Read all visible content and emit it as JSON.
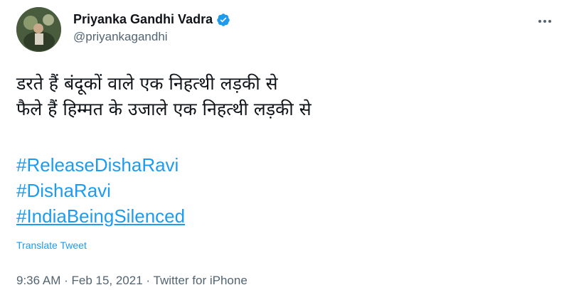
{
  "author": {
    "display_name": "Priyanka Gandhi Vadra",
    "handle": "@priyankagandhi",
    "verified": true
  },
  "tweet": {
    "lines": [
      "डरते हैं बंदूकों वाले एक निहत्थी लड़की से",
      "फैले हैं हिम्मत के उजाले एक निहत्थी लड़की से"
    ],
    "hashtags": [
      "#ReleaseDishaRavi",
      "#DishaRavi",
      "#IndiaBeingSilenced"
    ],
    "translate_label": "Translate Tweet"
  },
  "meta": {
    "time": "9:36 AM",
    "separator": " · ",
    "date": "Feb 15, 2021",
    "source": "Twitter for iPhone"
  },
  "colors": {
    "link": "#1d9bf0",
    "secondary_text": "#536471",
    "primary_text": "#0f1419"
  },
  "icons": {
    "verified": "verified-badge-icon",
    "more": "more-options-icon"
  }
}
